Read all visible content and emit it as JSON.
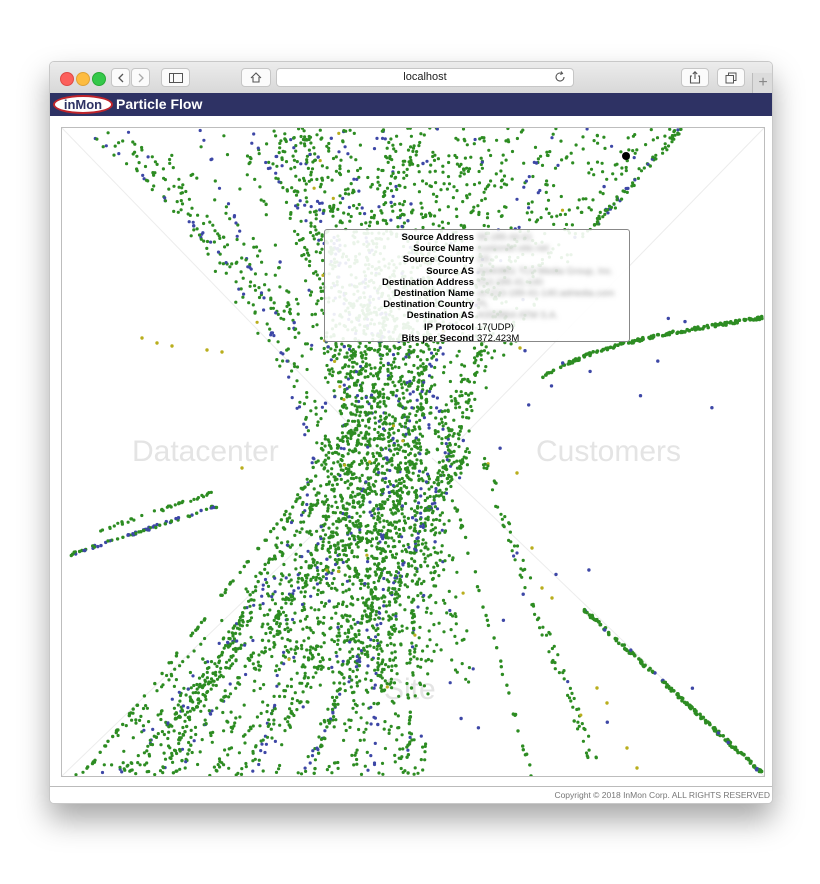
{
  "browser": {
    "address": "localhost",
    "colors": {
      "red": "#fc605c",
      "yellow": "#fdbc40",
      "green": "#34c84a"
    }
  },
  "app": {
    "logo_text": "inMon",
    "title": "Particle Flow",
    "bar_color": "#2e3264"
  },
  "zones": {
    "datacenter": "Datacenter",
    "customers": "Customers",
    "site": "Site"
  },
  "tooltip": {
    "rows": [
      {
        "key": "Source Address",
        "value": "95.189.44.61"
      },
      {
        "key": "Source Name",
        "value": "customer.site.net"
      },
      {
        "key": "Source Country",
        "value": "US"
      },
      {
        "key": "Source AS",
        "value": "AS40861 TLV Media Group, Inc."
      },
      {
        "key": "Destination Address",
        "value": "213.189.41.140"
      },
      {
        "key": "Destination Name",
        "value": "xx-213-189-41-140.adriedia.com"
      },
      {
        "key": "Destination Country",
        "value": "PL"
      },
      {
        "key": "Destination AS",
        "value": "AS53864 ATM S.A."
      },
      {
        "key": "IP Protocol",
        "value": "17(UDP)"
      },
      {
        "key": "Bits per Second",
        "value": "372.423M"
      }
    ]
  },
  "particles": {
    "colors": {
      "tcp": "#2d8c22",
      "udp": "#3d47a6",
      "other": "#b9ae1d",
      "selected": "#000000"
    }
  },
  "footer": {
    "copyright": "Copyright © 2018 InMon Corp. ALL RIGHTS RESERVED"
  }
}
